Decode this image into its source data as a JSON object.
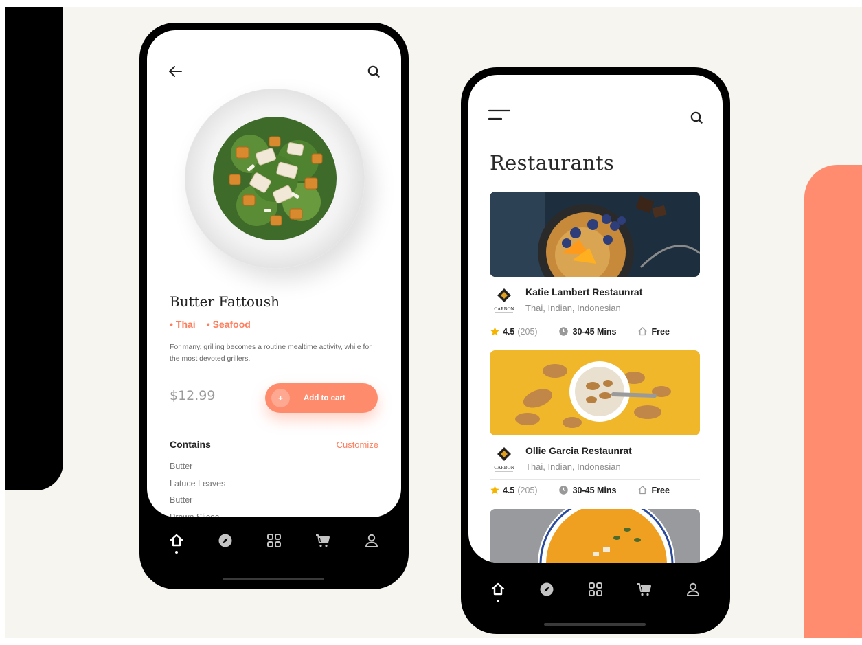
{
  "colors": {
    "accent": "#ff7d5c",
    "coral_panel": "#ff8c6e",
    "background": "#f6f5f0",
    "star": "#f5b400"
  },
  "dish_screen": {
    "header": {
      "back_icon": "arrow-left-icon",
      "search_icon": "search-icon"
    },
    "dish": {
      "name": "Butter Fattoush",
      "tags": [
        "Thai",
        "Seafood"
      ],
      "description": "For many, grilling becomes a routine mealtime activity, while for the most devoted grillers.",
      "price": "$12.99"
    },
    "add_to_cart": {
      "plus": "+",
      "label": "Add to cart"
    },
    "contains": {
      "title": "Contains",
      "customize_label": "Customize",
      "items": [
        "Butter",
        "Latuce Leaves",
        "Butter",
        "Prawn Slices"
      ]
    },
    "nav": {
      "items": [
        "home-icon",
        "compass-icon",
        "grid-icon",
        "cart-icon",
        "user-icon"
      ],
      "active": "home-icon"
    }
  },
  "restaurants_screen": {
    "header": {
      "menu_icon": "menu-icon",
      "search_icon": "search-icon"
    },
    "title": "Restaurants",
    "restaurants": [
      {
        "name": "Katie Lambert Restaunrat",
        "cuisine": "Thai, Indian, Indonesian",
        "rating": "4.5",
        "reviews": "(205)",
        "time": "30-45 Mins",
        "delivery": "Free",
        "logo_text": "CARBON"
      },
      {
        "name": "Ollie Garcia Restaunrat",
        "cuisine": "Thai, Indian, Indonesian",
        "rating": "4.5",
        "reviews": "(205)",
        "time": "30-45 Mins",
        "delivery": "Free",
        "logo_text": "CARBON"
      }
    ],
    "nav": {
      "items": [
        "home-icon",
        "compass-icon",
        "grid-icon",
        "cart-icon",
        "user-icon"
      ],
      "active": "home-icon"
    }
  }
}
